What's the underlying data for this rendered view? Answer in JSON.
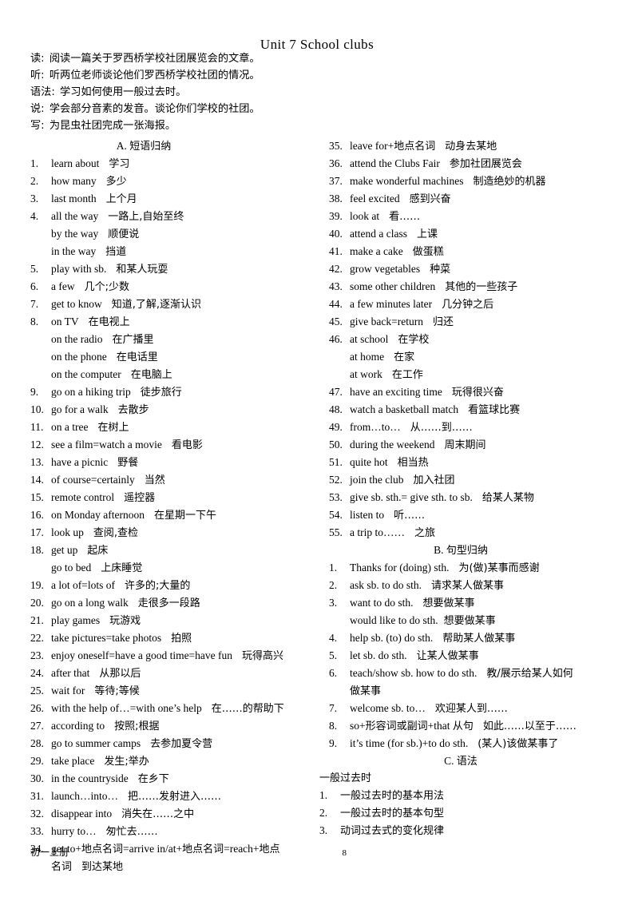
{
  "document": {
    "title": "Unit 7 School clubs",
    "footer_left": "初一上册",
    "footer_page": "8"
  },
  "intro": {
    "lines": [
      {
        "label": "读:",
        "text": "阅读一篇关于罗西桥学校社团展览会的文章。"
      },
      {
        "label": "听:",
        "text": "听两位老师谈论他们罗西桥学校社团的情况。"
      },
      {
        "label": "语法:",
        "text": "学习如何使用一般过去时。"
      },
      {
        "label": "说:",
        "text": "学会部分音素的发音。谈论你们学校的社团。"
      },
      {
        "label": "写:",
        "text": "为昆虫社团完成一张海报。"
      }
    ]
  },
  "sections": {
    "a": {
      "letter": "A.",
      "title": "短语归纳"
    },
    "b": {
      "letter": "B.",
      "title": "句型归纳"
    },
    "c": {
      "letter": "C.",
      "title": "语法"
    }
  },
  "phrases_left": [
    {
      "num": "1.",
      "en": "learn about",
      "cn": "学习"
    },
    {
      "num": "2.",
      "en": "how many",
      "cn": "多少"
    },
    {
      "num": "3.",
      "en": "last month",
      "cn": "上个月"
    },
    {
      "num": "4.",
      "en": "all the way",
      "cn": "一路上,自始至终"
    },
    {
      "num": "",
      "en": "by the way",
      "cn": "顺便说",
      "cont": true
    },
    {
      "num": "",
      "en": "in the way",
      "cn": "挡道",
      "cont": true
    },
    {
      "num": "5.",
      "en": "play with sb.",
      "cn": "和某人玩耍"
    },
    {
      "num": "6.",
      "en": "a few",
      "cn": "几个;少数"
    },
    {
      "num": "7.",
      "en": "get to know",
      "cn": "知道,了解,逐渐认识"
    },
    {
      "num": "8.",
      "en": "on TV",
      "cn": "在电视上"
    },
    {
      "num": "",
      "en": "on the radio",
      "cn": "在广播里",
      "cont": true
    },
    {
      "num": "",
      "en": "on the phone",
      "cn": "在电话里",
      "cont": true
    },
    {
      "num": "",
      "en": "on the computer",
      "cn": "在电脑上",
      "cont": true
    },
    {
      "num": "9.",
      "en": "go on a hiking trip",
      "cn": "徒步旅行"
    },
    {
      "num": "10.",
      "en": "go for a walk",
      "cn": "去散步"
    },
    {
      "num": "11.",
      "en": "on a tree",
      "cn": "在树上"
    },
    {
      "num": "12.",
      "en": "see a film=watch a movie",
      "cn": "看电影"
    },
    {
      "num": "13.",
      "en": "have a picnic",
      "cn": "野餐"
    },
    {
      "num": "14.",
      "en": "of course=certainly",
      "cn": "当然"
    },
    {
      "num": "15.",
      "en": "remote control",
      "cn": "遥控器"
    },
    {
      "num": "16.",
      "en": "on Monday afternoon",
      "cn": "在星期一下午"
    },
    {
      "num": "17.",
      "en": "look up",
      "cn": "查阅,查检"
    },
    {
      "num": "18.",
      "en": "get up",
      "cn": "起床"
    },
    {
      "num": "",
      "en": "go to bed",
      "cn": "上床睡觉",
      "cont": true
    },
    {
      "num": "19.",
      "en": "a lot of=lots of",
      "cn": "许多的;大量的"
    },
    {
      "num": "20.",
      "en": "go on a long walk",
      "cn": "走很多一段路"
    },
    {
      "num": "21.",
      "en": "play games",
      "cn": "玩游戏"
    },
    {
      "num": "22.",
      "en": "take pictures=take photos",
      "cn": "拍照"
    },
    {
      "num": "23.",
      "en": "enjoy oneself=have a good time=have fun",
      "cn": "玩得高兴"
    },
    {
      "num": "24.",
      "en": "after that",
      "cn": "从那以后"
    },
    {
      "num": "25.",
      "en": "wait for",
      "cn": "等待;等候"
    },
    {
      "num": "26.",
      "en": "with the help of…=with one’s help",
      "cn": "在……的帮助下"
    },
    {
      "num": "27.",
      "en": "according to",
      "cn": "按照;根据"
    },
    {
      "num": "28.",
      "en": "go to summer camps",
      "cn": "去参加夏令营"
    },
    {
      "num": "29.",
      "en": "take place",
      "cn": "发生;举办"
    },
    {
      "num": "30.",
      "en": "in the countryside",
      "cn": "在乡下"
    },
    {
      "num": "31.",
      "en": "launch…into…",
      "cn": "把……发射进入……"
    },
    {
      "num": "32.",
      "en": "disappear into",
      "cn": "消失在……之中"
    },
    {
      "num": "33.",
      "en": "hurry to…",
      "cn": "匆忙去……"
    },
    {
      "num": "34.",
      "en": "get to+地点名词=arrive in/at+地点名词=reach+地点",
      "cn": ""
    },
    {
      "num": "",
      "en": "名词",
      "cn": "到达某地",
      "cont": true,
      "cn_first": true
    }
  ],
  "phrases_right": [
    {
      "num": "35.",
      "en": "leave for+地点名词",
      "cn": "动身去某地"
    },
    {
      "num": "36.",
      "en": "attend the Clubs Fair",
      "cn": "参加社团展览会"
    },
    {
      "num": "37.",
      "en": "make wonderful machines",
      "cn": "制造绝妙的机器"
    },
    {
      "num": "38.",
      "en": "feel excited",
      "cn": "感到兴奋"
    },
    {
      "num": "39.",
      "en": "look at",
      "cn": "看……"
    },
    {
      "num": "40.",
      "en": "attend a class",
      "cn": "上课"
    },
    {
      "num": "41.",
      "en": "make a cake",
      "cn": "做蛋糕"
    },
    {
      "num": "42.",
      "en": "grow vegetables",
      "cn": "种菜"
    },
    {
      "num": "43.",
      "en": "some other children",
      "cn": "其他的一些孩子"
    },
    {
      "num": "44.",
      "en": "a few minutes later",
      "cn": "几分钟之后"
    },
    {
      "num": "45.",
      "en": "give back=return",
      "cn": "归还"
    },
    {
      "num": "46.",
      "en": "at school",
      "cn": "在学校"
    },
    {
      "num": "",
      "en": "at home",
      "cn": "在家",
      "cont": true
    },
    {
      "num": "",
      "en": "at work",
      "cn": "在工作",
      "cont": true
    },
    {
      "num": "47.",
      "en": "have an exciting time",
      "cn": "玩得很兴奋"
    },
    {
      "num": "48.",
      "en": "watch a basketball match",
      "cn": "看篮球比赛"
    },
    {
      "num": "49.",
      "en": "from…to…",
      "cn": "从……到……"
    },
    {
      "num": "50.",
      "en": "during the weekend",
      "cn": "周末期间"
    },
    {
      "num": "51.",
      "en": "quite hot",
      "cn": "相当热"
    },
    {
      "num": "52.",
      "en": "join the club",
      "cn": "加入社团"
    },
    {
      "num": "53.",
      "en": "give sb. sth.= give sth. to sb.",
      "cn": "给某人某物"
    },
    {
      "num": "54.",
      "en": "listen to",
      "cn": "听……"
    },
    {
      "num": "55.",
      "en": "a trip to……",
      "cn": "之旅"
    }
  ],
  "sentence_patterns": [
    {
      "num": "1.",
      "en": "Thanks for (doing) sth.",
      "cn": "为(做)某事而感谢"
    },
    {
      "num": "2.",
      "en": "ask sb. to do sth.",
      "cn": "请求某人做某事"
    },
    {
      "num": "3.",
      "en": "want to do sth.",
      "cn": "想要做某事"
    },
    {
      "num": "",
      "en": "would like to do sth.",
      "cn": "想要做某事",
      "cont": true,
      "tight": true
    },
    {
      "num": "4.",
      "en": "help sb. (to) do sth.",
      "cn": "帮助某人做某事"
    },
    {
      "num": "5.",
      "en": "let sb. do sth.",
      "cn": "让某人做某事"
    },
    {
      "num": "6.",
      "en": "teach/show sb. how to do sth.",
      "cn": "教/展示给某人如何"
    },
    {
      "num": "",
      "en": "",
      "cn": "做某事",
      "cont": true,
      "cn_first": true
    },
    {
      "num": "7.",
      "en": "welcome sb. to…",
      "cn": "欢迎某人到……"
    },
    {
      "num": "8.",
      "en": "so+形容词或副词+that 从句",
      "cn": "如此……以至于……"
    },
    {
      "num": "9.",
      "en": "it’s time (for sb.)+to do sth.",
      "cn": "(某人)该做某事了"
    }
  ],
  "grammar": {
    "heading": "一般过去时",
    "items": [
      {
        "num": "1.",
        "cn": "一般过去时的基本用法"
      },
      {
        "num": "2.",
        "cn": "一般过去时的基本句型"
      },
      {
        "num": "3.",
        "cn": "动词过去式的变化规律"
      }
    ]
  }
}
